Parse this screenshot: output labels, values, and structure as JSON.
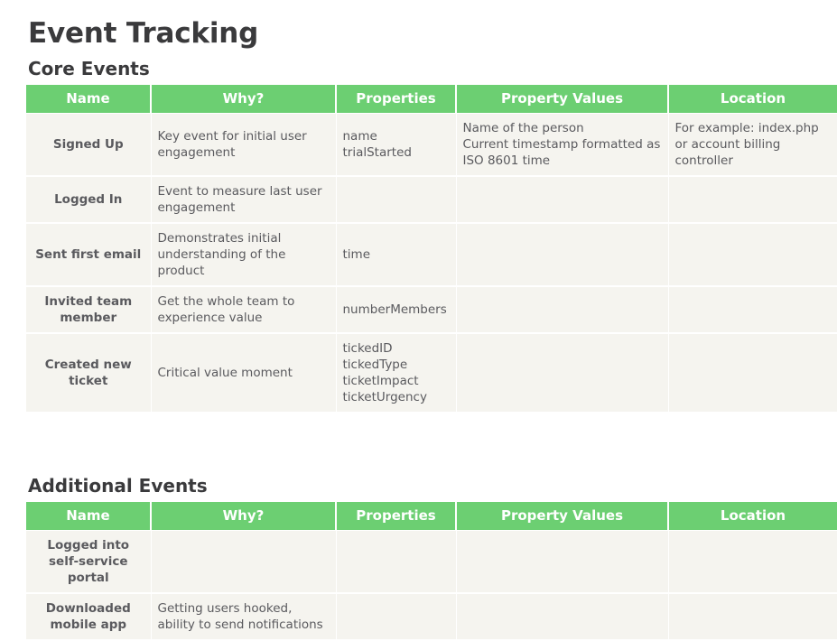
{
  "page": {
    "title": "Event Tracking"
  },
  "colors": {
    "header_green": "#6ccf72",
    "row_background": "#f5f4ef",
    "heading_text": "#3a3a3c",
    "body_text": "#5a5a5e",
    "grid_line": "#ffffff"
  },
  "columns": [
    {
      "key": "name",
      "label": "Name"
    },
    {
      "key": "why",
      "label": "Why?"
    },
    {
      "key": "properties",
      "label": "Properties"
    },
    {
      "key": "property_values",
      "label": "Property Values"
    },
    {
      "key": "location",
      "label": "Location"
    }
  ],
  "sections": [
    {
      "heading": "Core Events",
      "rows": [
        {
          "name": "Signed Up",
          "why": "Key event for initial user engagement",
          "properties": [
            "name",
            "trialStarted"
          ],
          "property_values": [
            "Name of the person",
            "Current timestamp formatted as ISO 8601 time"
          ],
          "location": [
            "For example: index.php or account billing controller"
          ]
        },
        {
          "name": "Logged In",
          "why": "Event to measure last user engagement",
          "properties": [],
          "property_values": [],
          "location": []
        },
        {
          "name": "Sent first email",
          "why": "Demonstrates initial understanding of the product",
          "properties": [
            "time"
          ],
          "property_values": [],
          "location": []
        },
        {
          "name": "Invited team member",
          "why": "Get the whole team to experience value",
          "properties": [
            "numberMembers"
          ],
          "property_values": [],
          "location": []
        },
        {
          "name": "Created new ticket",
          "why": "Critical value moment",
          "properties": [
            "tickedID",
            "tickedType",
            "ticketImpact",
            "ticketUrgency"
          ],
          "property_values": [],
          "location": []
        }
      ]
    },
    {
      "heading": "Additional Events",
      "rows": [
        {
          "name": "Logged into self-service portal",
          "why": "",
          "properties": [],
          "property_values": [],
          "location": []
        },
        {
          "name": "Downloaded mobile app",
          "why": "Getting users hooked, ability to send notifications",
          "properties": [],
          "property_values": [],
          "location": []
        }
      ]
    }
  ]
}
